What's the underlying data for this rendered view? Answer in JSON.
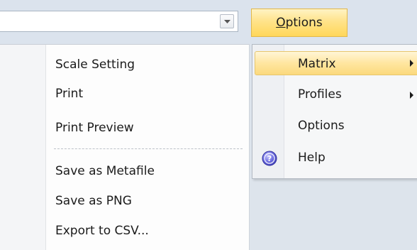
{
  "toolbar": {
    "options_label_accel": "O",
    "options_label_rest": "ptions"
  },
  "context_menu": {
    "items": [
      {
        "label": "Scale Setting"
      },
      {
        "label": "Print"
      },
      {
        "label": "Print Preview"
      },
      {
        "label": "Save as Metafile"
      },
      {
        "label": "Save as PNG"
      },
      {
        "label": "Export to CSV..."
      }
    ]
  },
  "submenu": {
    "items": [
      {
        "label": "Matrix",
        "has_submenu": true,
        "highlighted": true
      },
      {
        "label": "Profiles",
        "has_submenu": true
      },
      {
        "label": "Options"
      },
      {
        "label": "Help",
        "icon": "help-icon"
      }
    ]
  },
  "colors": {
    "highlight": "#ffe38a",
    "help_icon": "#5b5bd6"
  }
}
